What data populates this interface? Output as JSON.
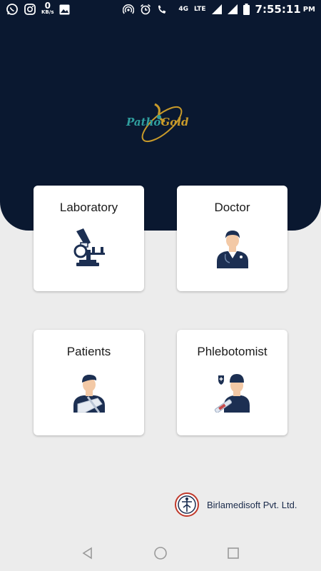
{
  "status_bar": {
    "net_speed_value": "0",
    "net_speed_unit": "KB/s",
    "network_type": "LTE",
    "network_4g": "4G",
    "time": "7:55:11",
    "ampm": "PM",
    "icons": [
      "whatsapp-icon",
      "instagram-icon",
      "gallery-icon",
      "hotspot-icon",
      "alarm-icon",
      "volte-call-icon",
      "signal-icon",
      "signal-icon",
      "battery-icon"
    ]
  },
  "logo": {
    "text_left": "Patho",
    "text_right": "Gold",
    "colors": {
      "teal": "#2f9e9e",
      "gold": "#c89a2a"
    }
  },
  "menu": {
    "items": [
      {
        "label": "Laboratory",
        "icon": "microscope-icon"
      },
      {
        "label": "Doctor",
        "icon": "doctor-icon"
      },
      {
        "label": "Patients",
        "icon": "patient-icon"
      },
      {
        "label": "Phlebotomist",
        "icon": "phlebotomist-icon"
      }
    ]
  },
  "footer": {
    "brand": "Birlamedisoft Pvt. Ltd."
  },
  "theme": {
    "header": "#0a1830",
    "background": "#ececec",
    "icon_navy": "#1c2f52"
  }
}
